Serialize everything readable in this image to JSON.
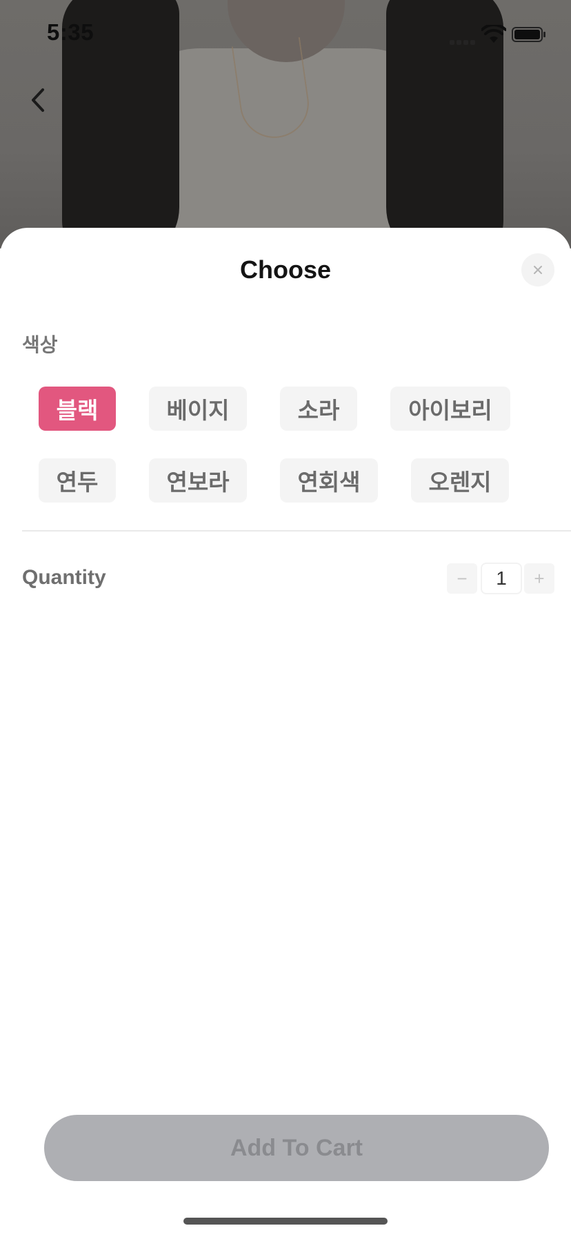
{
  "status_bar": {
    "time": "5:35"
  },
  "header": {
    "back_icon": "chevron-left-icon"
  },
  "sheet": {
    "title": "Choose",
    "close_icon": "close-icon",
    "color_section": {
      "label": "색상",
      "options": [
        {
          "label": "블랙",
          "selected": true
        },
        {
          "label": "베이지",
          "selected": false
        },
        {
          "label": "소라",
          "selected": false
        },
        {
          "label": "아이보리",
          "selected": false
        },
        {
          "label": "연두",
          "selected": false
        },
        {
          "label": "연보라",
          "selected": false
        },
        {
          "label": "연회색",
          "selected": false
        },
        {
          "label": "오렌지",
          "selected": false
        }
      ]
    },
    "quantity": {
      "label": "Quantity",
      "value": "1",
      "minus": "−",
      "plus": "+"
    },
    "add_to_cart_label": "Add To Cart"
  },
  "colors": {
    "accent": "#e2577f",
    "chip_bg": "#f4f4f4",
    "cart_button_bg": "#aeafb3"
  }
}
